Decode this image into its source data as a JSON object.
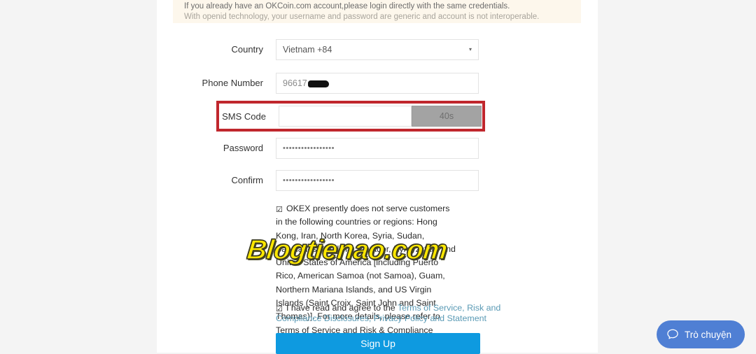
{
  "notice": {
    "line1": "If you already have an OKCoin.com account,please login directly with the same credentials.",
    "line2": "With openid technology, your username and password are generic and account is not interoperable."
  },
  "form": {
    "country": {
      "label": "Country",
      "value": "Vietnam +84",
      "caret": "▾"
    },
    "phone": {
      "label": "Phone Number",
      "value": "96617"
    },
    "sms": {
      "label": "SMS Code",
      "value": "",
      "timer_label": "40s",
      "highlight_color": "#c0272d"
    },
    "password": {
      "label": "Password",
      "value": "•••••••••••••••••"
    },
    "confirm": {
      "label": "Confirm",
      "value": "•••••••••••••••••"
    }
  },
  "disclaimer": {
    "checkbox_glyph": "☑",
    "text": "OKEX presently does not serve customers in the following countries or regions: Hong Kong, Iran, North Korea, Syria, Sudan, Bangladesh, Bolivia, Ecuador, Kyrgyzstan, and United States of America [including Puerto Rico, American Samoa (not Samoa), Guam, Northern Mariana Islands, and US Virgin Islands (Saint Croix, Saint John and Saint Thomas)]. For more details, please refer to Terms of Service and Risk & Compliance Disclosures."
  },
  "agreement": {
    "checkbox_glyph": "☑",
    "prefix": "I have read and agree to the",
    "links": "Terms of Service, Risk and Compliance Disclosures, Privacy Policy and Statement",
    "link_color": "#5a9ab5"
  },
  "signup": {
    "label": "Sign Up",
    "color": "#0e9ae0"
  },
  "watermark": {
    "text": "Blogtienao.com",
    "color": "#ffe800"
  },
  "chat": {
    "label": "Trò chuyện",
    "icon": "chat-bubble-icon",
    "color": "#4f7fd4"
  }
}
